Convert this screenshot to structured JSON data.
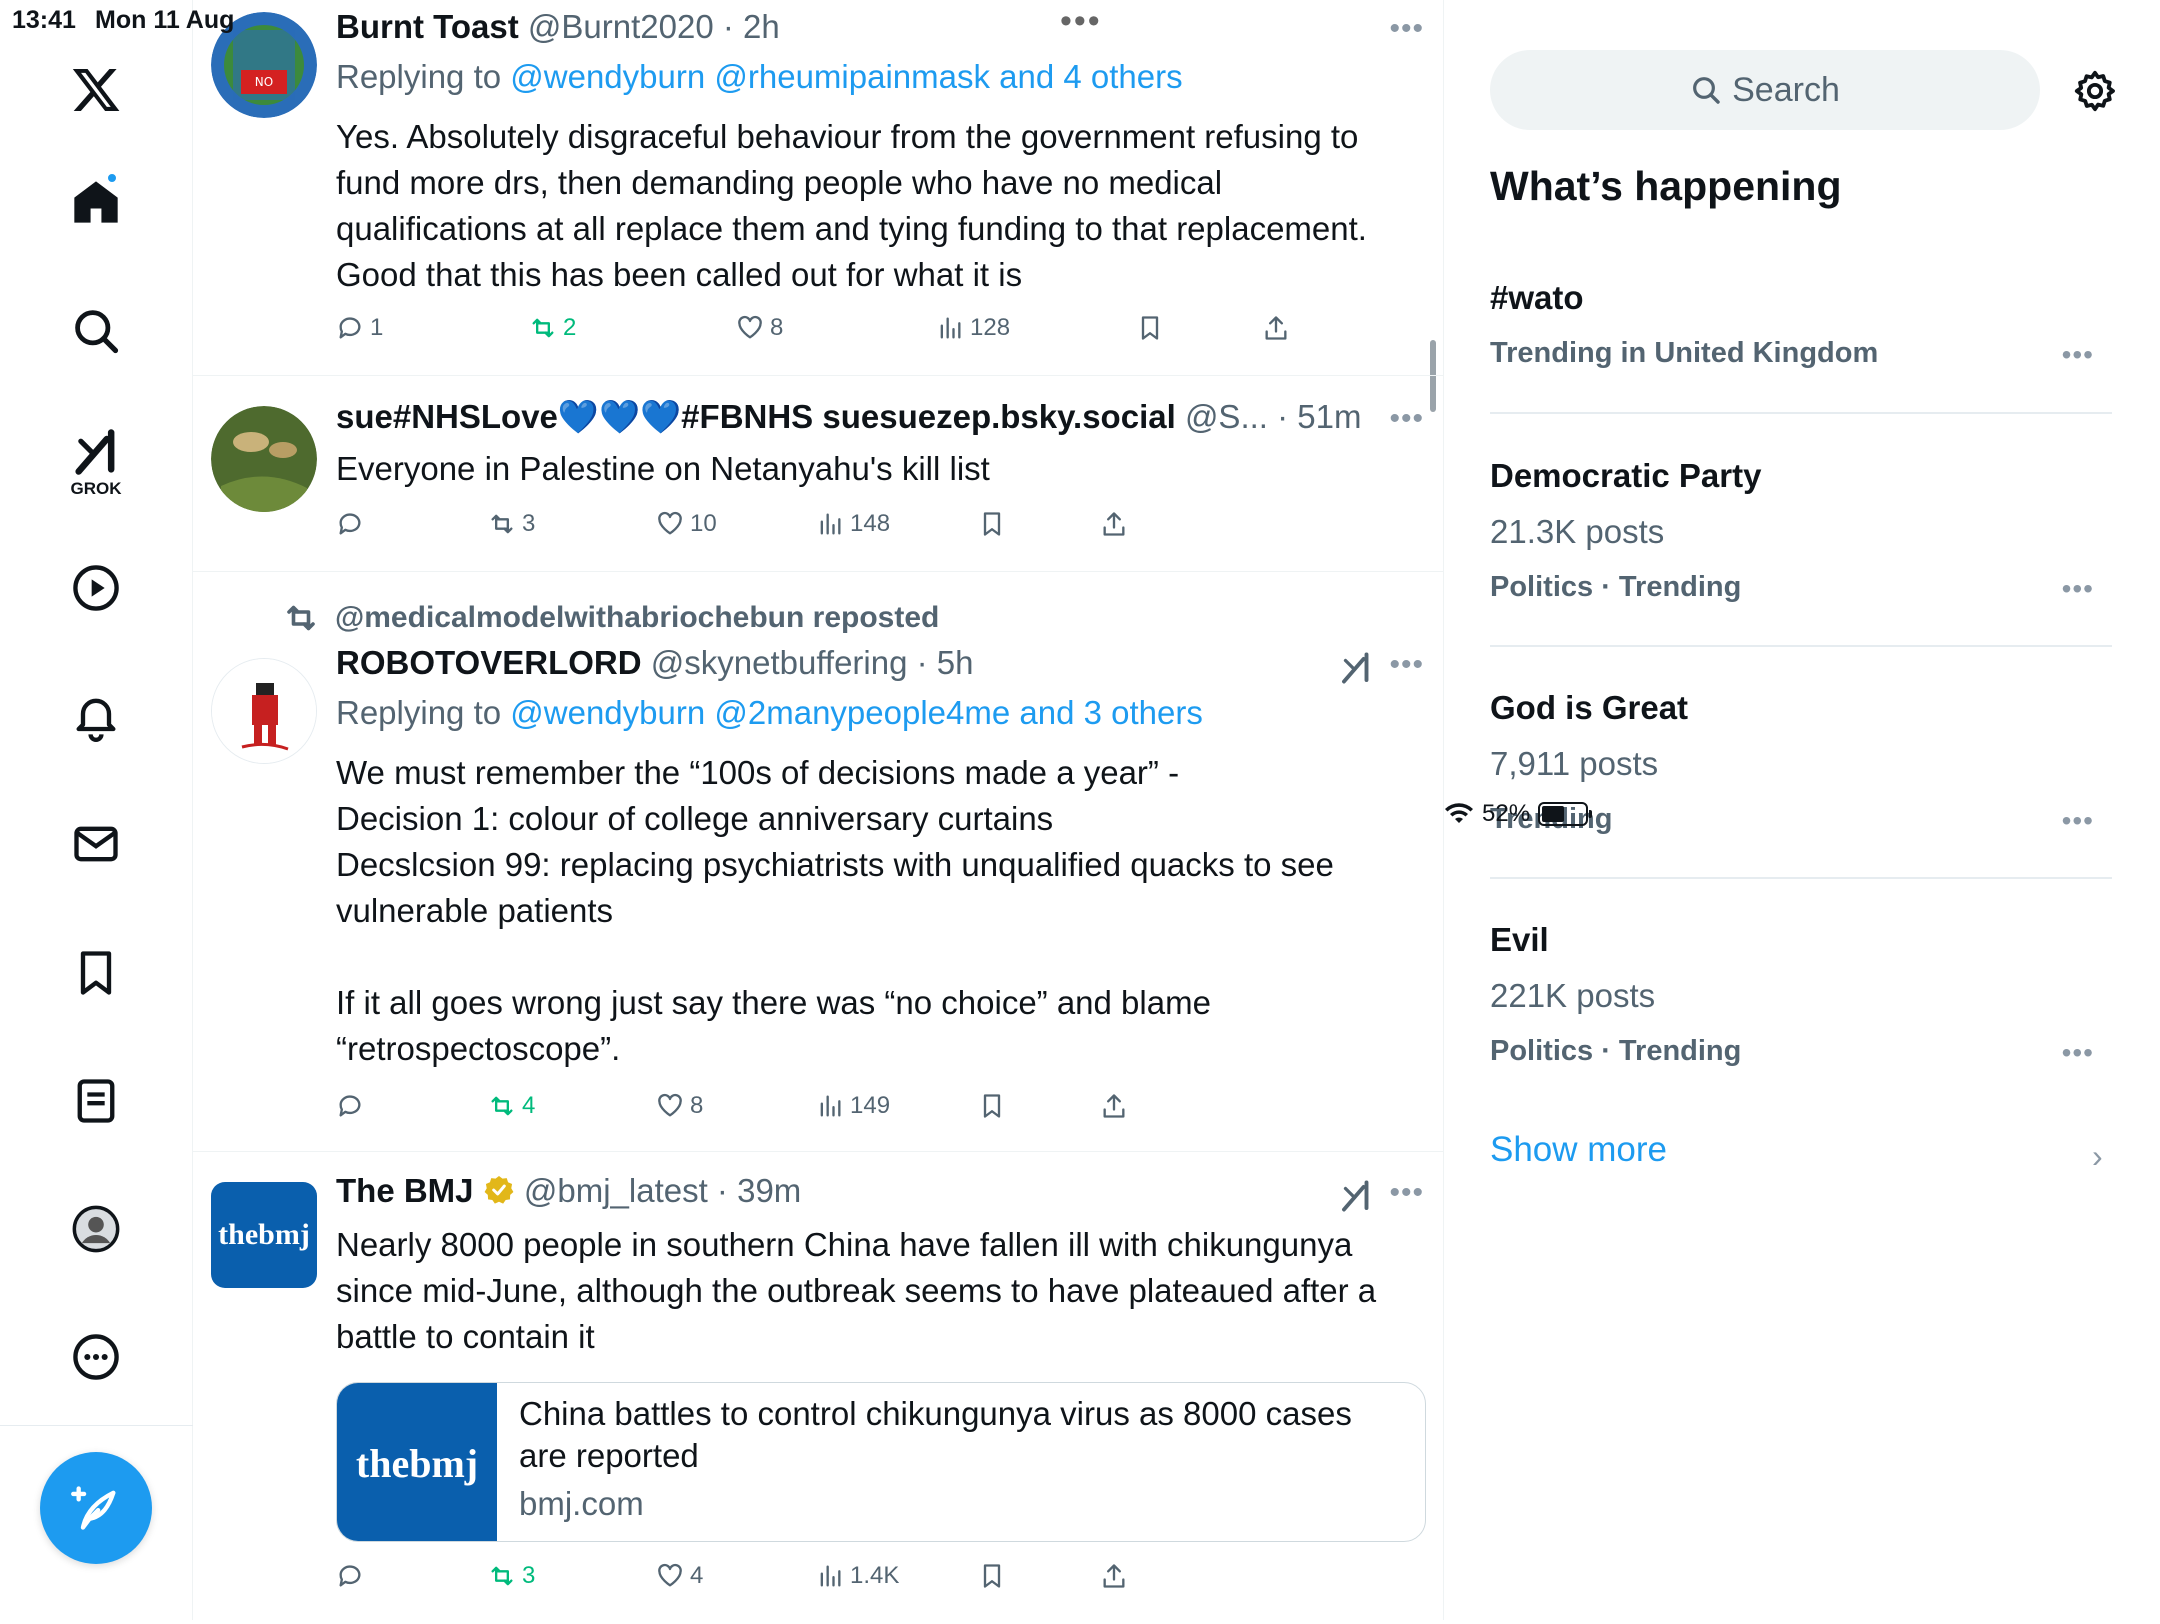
{
  "status": {
    "time": "13:41",
    "date": "Mon 11 Aug",
    "battery_percent": "52%",
    "battery_level": 0.52
  },
  "nav": {
    "grok_label": "GROK",
    "icons": [
      "x-logo-icon",
      "home-icon",
      "search-icon",
      "grok-icon",
      "video-icon",
      "notifications-icon",
      "messages-icon",
      "bookmarks-icon",
      "lists-icon",
      "profile-icon",
      "more-icon"
    ]
  },
  "tweets": [
    {
      "name": "Burnt Toast",
      "handle": "@Burnt2020",
      "time": "2h",
      "reply_prefix": "Replying to ",
      "reply_to": "@wendyburn @rheumipainmask and 4 others",
      "body": [
        "Yes. Absolutely disgraceful behaviour from the government refusing to",
        "fund more drs, then demanding people who have no medical",
        "qualifications at all replace them and tying funding to that replacement.",
        "Good that this has been called out for what it is"
      ],
      "replies": "1",
      "reposts": "2",
      "likes": "8",
      "views": "128"
    },
    {
      "name": "sue#NHSLove💙💙💙#FBNHS suesuezep.bsky.social",
      "handle": "@S...",
      "time": "51m",
      "body": [
        "Everyone in Palestine on Netanyahu's kill list"
      ],
      "replies": "",
      "reposts": "3",
      "likes": "10",
      "views": "148"
    },
    {
      "reposted_by": "@medicalmodelwithabriochebun reposted",
      "name": "ROBOTOVERLORD",
      "handle": "@skynetbuffering",
      "time": "5h",
      "reply_prefix": "Replying to ",
      "reply_to": "@wendyburn @2manypeople4me and 3 others",
      "body": [
        "We must remember the “100s of decisions made a year” -",
        "Decision 1: colour of college anniversary curtains",
        "Decslcsion 99: replacing psychiatrists with unqualified quacks to see",
        "vulnerable patients",
        "",
        "If it all goes wrong just say there was “no choice” and blame",
        "“retrospectoscope”."
      ],
      "replies": "",
      "reposts": "4",
      "likes": "8",
      "views": "149"
    },
    {
      "name": "The BMJ",
      "handle": "@bmj_latest",
      "time": "39m",
      "avatar_text": "thebmj",
      "body": [
        "Nearly 8000 people in southern China have fallen ill with chikungunya",
        "since mid-June, although the outbreak seems to have plateaued after a",
        "battle to contain it"
      ],
      "card": {
        "thumb_text": "thebmj",
        "title": "China battles to control chikungunya virus as 8000 cases are reported",
        "domain": "bmj.com"
      },
      "replies": "",
      "reposts": "3",
      "likes": "4",
      "views": "1.4K"
    }
  ],
  "sidebar": {
    "search_placeholder": "Search",
    "title": "What’s happening",
    "trends": [
      {
        "name": "#wato",
        "posts": "",
        "meta": "Trending in United Kingdom"
      },
      {
        "name": "Democratic Party",
        "posts": "21.3K posts",
        "meta": "Politics · Trending"
      },
      {
        "name": "God is Great",
        "posts": "7,911 posts",
        "meta": "Trending"
      },
      {
        "name": "Evil",
        "posts": "221K posts",
        "meta": "Politics · Trending"
      }
    ],
    "show_more": "Show more"
  },
  "colors": {
    "accent": "#1d9bf0",
    "repost_green": "#00ba7c",
    "text": "#0f1419",
    "secondary": "#536471",
    "bmj_blue": "#0a5fad"
  }
}
